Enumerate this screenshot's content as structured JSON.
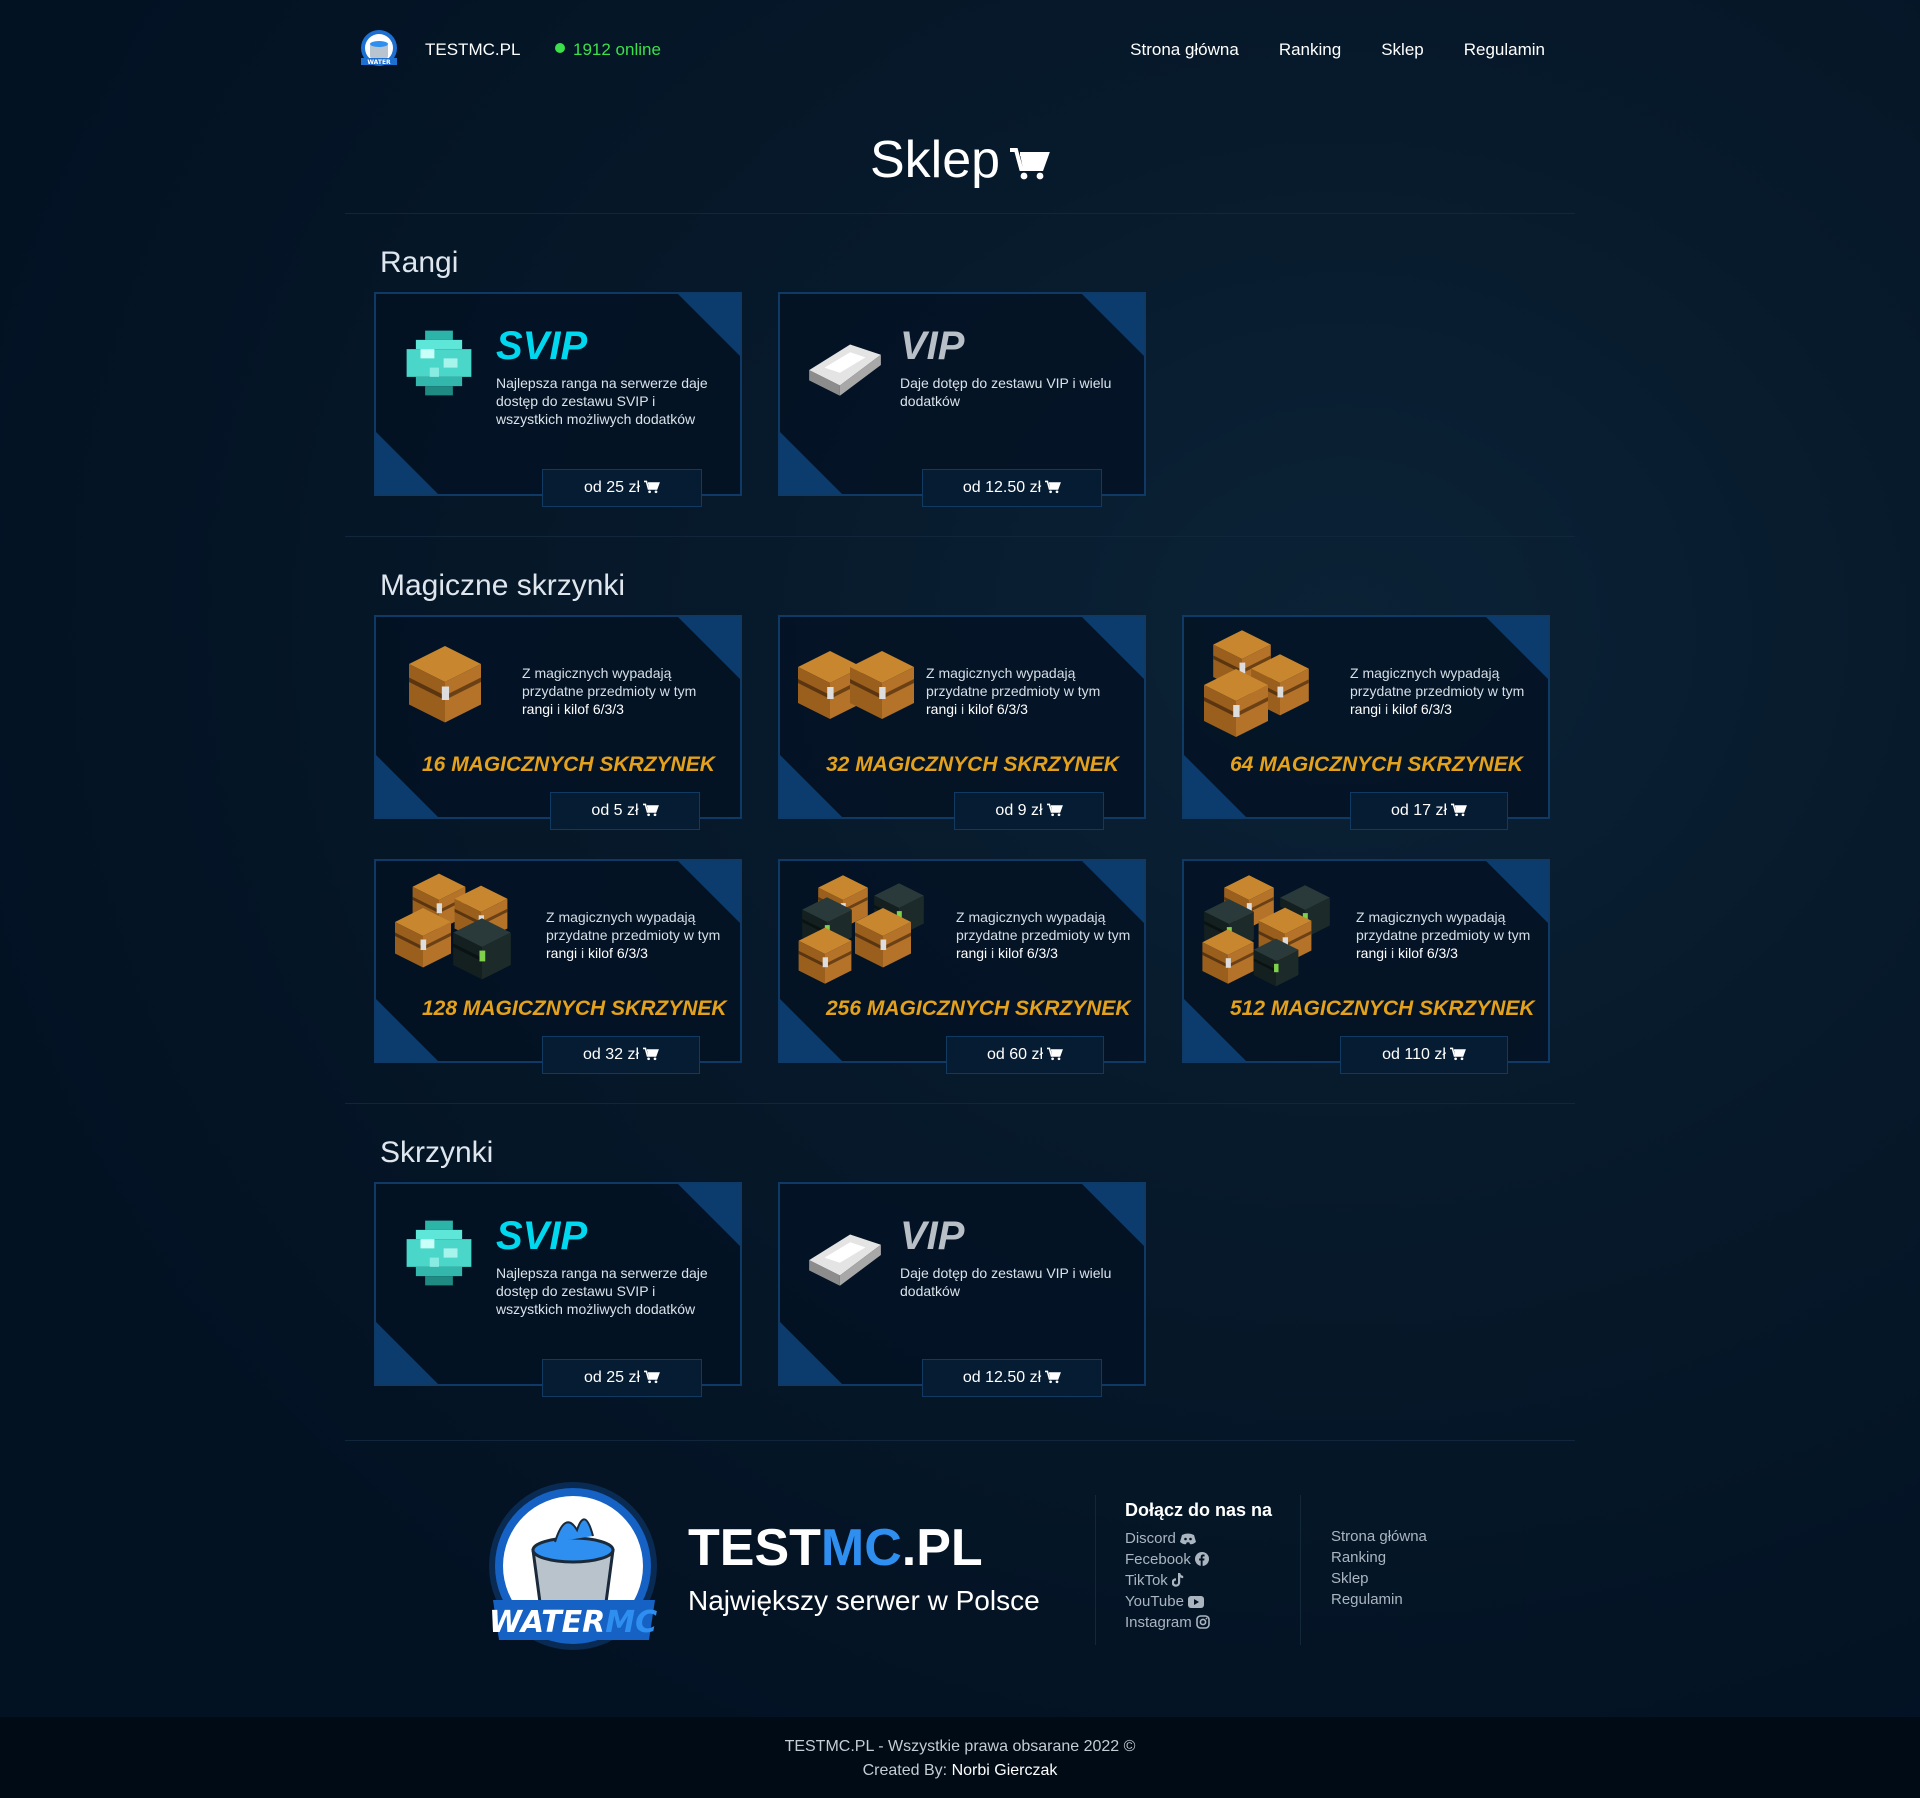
{
  "nav": {
    "brand": "TESTMC.PL",
    "online": "1912 online",
    "links": [
      "Strona główna",
      "Ranking",
      "Sklep",
      "Regulamin"
    ]
  },
  "page": {
    "title": "Sklep"
  },
  "sections": {
    "rangi": "Rangi",
    "magiczne": "Magiczne skrzynki",
    "skrzynki": "Skrzynki"
  },
  "ranks": {
    "svip": {
      "name": "SVIP",
      "desc": "Najlepsza ranga na serwerze daje dostęp do zestawu SVIP i wszystkich możliwych dodatków",
      "price": "od 25 zł",
      "color": "#00d8f0"
    },
    "vip": {
      "name": "VIP",
      "desc": "Daje dotęp do zestawu VIP i wielu dodatków",
      "price": "od 12.50 zł",
      "color": "#b9bfc6"
    }
  },
  "chest_desc": {
    "pre": "Z magicznych wypadają przydatne przedmioty w tym ",
    "rangi": "rangi",
    "mid": " i ",
    "kilof": "kilof 6/3/3"
  },
  "chests": [
    {
      "name": "16 MAGICZNYCH SKRZYNEK",
      "price": "od 5 zł"
    },
    {
      "name": "32 MAGICZNYCH SKRZYNEK",
      "price": "od 9 zł"
    },
    {
      "name": "64 MAGICZNYCH SKRZYNEK",
      "price": "od 17 zł"
    },
    {
      "name": "128 MAGICZNYCH SKRZYNEK",
      "price": "od 32 zł"
    },
    {
      "name": "256 MAGICZNYCH SKRZYNEK",
      "price": "od 60 zł"
    },
    {
      "name": "512 MAGICZNYCH SKRZYNEK",
      "price": "od 110 zł"
    }
  ],
  "footer": {
    "brand_a": "TEST",
    "brand_b": "MC",
    "brand_c": ".PL",
    "tagline": "Największy serwer w Polsce",
    "join": "Dołącz do nas na",
    "social": [
      "Discord",
      "Fecebook",
      "TikTok",
      "YouTube",
      "Instagram"
    ],
    "links": [
      "Strona główna",
      "Ranking",
      "Sklep",
      "Regulamin"
    ],
    "copyright": "TESTMC.PL - Wszystkie prawa obsarane 2022 ©",
    "created_label": "Created By: ",
    "author": "Norbi Gierczak"
  },
  "colors": {
    "accent": "#2e8ff0",
    "gold": "#e4a11b",
    "online": "#3be04a",
    "card_border": "#0f3a66"
  }
}
